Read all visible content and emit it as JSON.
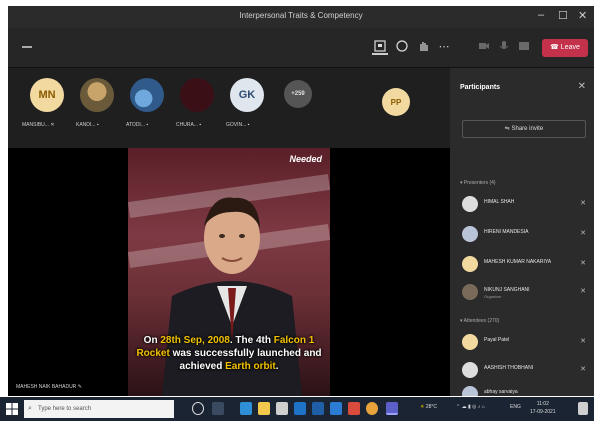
{
  "window": {
    "title": "Interpersonal Traits & Competency",
    "minimize": "–",
    "restore": "☐",
    "close": "✕"
  },
  "toolbar": {
    "leave_label": "Leave",
    "more": "⋯"
  },
  "avatars": [
    {
      "initials": "MN",
      "label": "MANSIBU...",
      "color": "#f1d9a0",
      "text_color": "#8a5a00"
    },
    {
      "initials": "",
      "label": "KANDI...",
      "color": "#6a5a3a"
    },
    {
      "initials": "",
      "label": "ATODI...",
      "color": "#2f5a8a"
    },
    {
      "initials": "",
      "label": "CHURA...",
      "color": "#3a1016"
    },
    {
      "initials": "GK",
      "label": "GOVIN...",
      "color": "#dfe6ee",
      "text_color": "#2f4c73"
    },
    {
      "initials": "+259",
      "label": "",
      "color": "#555555",
      "text_color": "#e0e0e0"
    },
    {
      "initials": "PP",
      "label": "",
      "color": "#f1d9a0",
      "text_color": "#8a5a00"
    }
  ],
  "video": {
    "brand": "Needed",
    "caption_parts": [
      {
        "text": "On ",
        "hl": false
      },
      {
        "text": "28th Sep, 2008",
        "hl": true
      },
      {
        "text": ". The 4th ",
        "hl": false
      },
      {
        "text": "Falcon 1",
        "hl": true
      },
      {
        "text": " ",
        "hl": false
      },
      {
        "text": "Rocket",
        "hl": true
      },
      {
        "text": " was successfully launched and achieved ",
        "hl": false
      },
      {
        "text": "Earth orbit",
        "hl": true
      },
      {
        "text": ".",
        "hl": false
      }
    ],
    "presenter_label": "MAHESH NAIK BAHADUR"
  },
  "participants": {
    "title": "Participants",
    "share_invite": "Share invite",
    "presenters_header": "Presenters (4)",
    "presenters": [
      {
        "name": "HIMAL SHAH",
        "sub": "",
        "color": "#ddd"
      },
      {
        "name": "HIRENI MANDESIA",
        "sub": "",
        "color": "#b9c4d8"
      },
      {
        "name": "MAHESH KUMAR NAKARIYA",
        "sub": "",
        "color": "#f1d9a0"
      },
      {
        "name": "NIKUNJ SANGHANI",
        "sub": "Organizer",
        "color": "#7a6a5a"
      }
    ],
    "attendees_header": "Attendees (270)",
    "attendees": [
      {
        "name": "Payal Patel",
        "color": "#f1d9a0"
      },
      {
        "name": "AASHISH THOBHANI",
        "color": "#ddd"
      },
      {
        "name": "abhay sarvaiya",
        "color": "#b9c4d8"
      }
    ]
  },
  "taskbar": {
    "search_placeholder": "Type here to search",
    "weather": "28°C",
    "lang": "ENG",
    "time": "11:02",
    "date": "17-09-2021"
  }
}
